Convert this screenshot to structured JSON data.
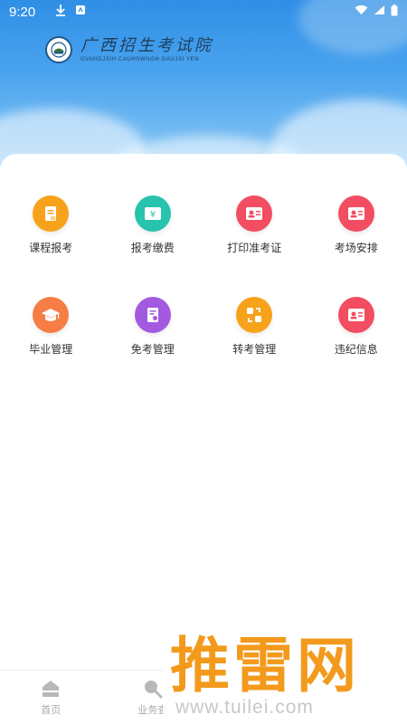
{
  "status": {
    "time": "9:20"
  },
  "brand": {
    "name_cn": "广西招生考试院",
    "name_en": "GVANGJSIH CAUHSWNGH GAUJSI YEN"
  },
  "menu": [
    {
      "label": "课程报考",
      "icon": "document-icon",
      "color": "#f7a21b"
    },
    {
      "label": "报考缴费",
      "icon": "yuan-payment-icon",
      "color": "#27c3ad"
    },
    {
      "label": "打印准考证",
      "icon": "id-card-icon",
      "color": "#f24d61"
    },
    {
      "label": "考场安排",
      "icon": "id-card-icon",
      "color": "#f24d61"
    },
    {
      "label": "毕业管理",
      "icon": "graduation-cap-icon",
      "color": "#f67d44"
    },
    {
      "label": "免考管理",
      "icon": "certificate-icon",
      "color": "#a35ae0"
    },
    {
      "label": "转考管理",
      "icon": "transfer-icon",
      "color": "#f7a21b"
    },
    {
      "label": "违纪信息",
      "icon": "id-card-icon",
      "color": "#f24d61"
    }
  ],
  "bottom_nav": [
    {
      "label": "首页",
      "icon": "home-icon"
    },
    {
      "label": "业务查",
      "icon": "search-icon"
    }
  ],
  "watermark": {
    "cn": "推雷网",
    "en": "www.tuilei.com"
  }
}
